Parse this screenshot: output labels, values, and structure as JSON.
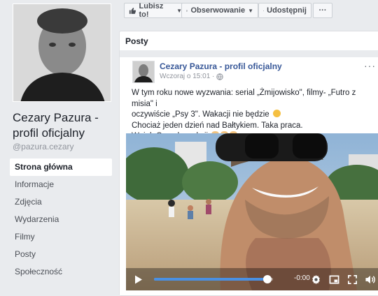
{
  "page": {
    "name": "Cezary Pazura - profil oficjalny",
    "handle": "@pazura.cezary"
  },
  "nav": [
    {
      "label": "Strona główna",
      "active": true
    },
    {
      "label": "Informacje"
    },
    {
      "label": "Zdjęcia"
    },
    {
      "label": "Wydarzenia"
    },
    {
      "label": "Filmy"
    },
    {
      "label": "Posty"
    },
    {
      "label": "Społeczność"
    }
  ],
  "actions": {
    "like": "Lubisz to!",
    "follow": "Obserwowanie",
    "share": "Udostępnij",
    "more": "···"
  },
  "posts": {
    "header": "Posty",
    "post": {
      "author": "Cezary Pazura - profil oficjalny",
      "timestamp": "Wczoraj o 15:01 ·",
      "options": "···",
      "lines": [
        "W tym roku nowe wyzwania: serial „Żmijowisko\", filmy- „Futro z misia\" i",
        "oczywiście „Psy 3\". Wakacji nie będzie",
        "Chociaż jeden dzień nad Bałtykiem. Taka praca.",
        "Wujek Czarek w akcji"
      ],
      "video": {
        "time": "-0:00",
        "progress": 0.95
      }
    }
  }
}
